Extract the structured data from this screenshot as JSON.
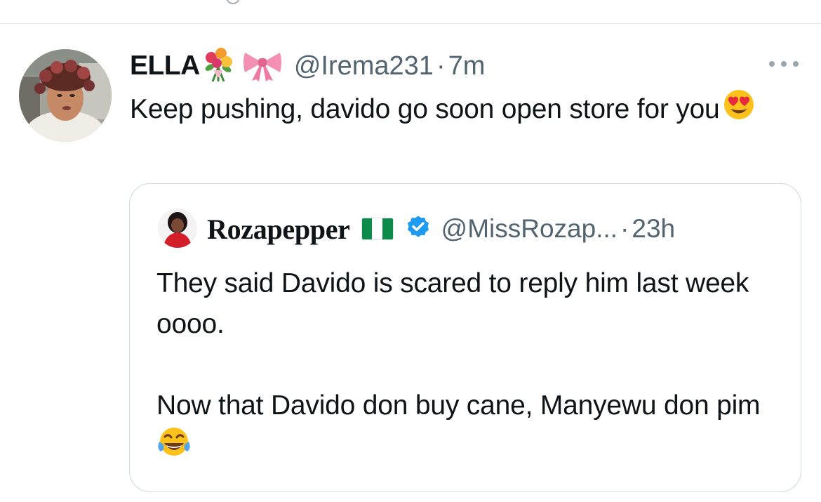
{
  "tweet": {
    "author_name": "ELLA",
    "name_emoji_1": "bouquet-icon",
    "name_emoji_2": "ribbon-icon",
    "handle": "@Irema231",
    "separator": "·",
    "time": "7m",
    "text": "Keep pushing, davido go soon open store for you",
    "text_emoji": "heart-eyes-icon"
  },
  "quoted_tweet": {
    "author_name": "Rozapepper",
    "flag": "nigeria-flag-icon",
    "verified": "verified-badge-icon",
    "handle": "@MissRozap...",
    "separator": "·",
    "time": "23h",
    "paragraph_1": "They said Davido is scared to reply him last week oooo.",
    "paragraph_2": "Now that Davido don buy cane, Manyewu don pim",
    "text_emoji": "tears-of-joy-icon"
  },
  "colors": {
    "text": "#0f1419",
    "secondary": "#536471",
    "verified": "#1d9bf0",
    "border": "#cfd9de"
  }
}
